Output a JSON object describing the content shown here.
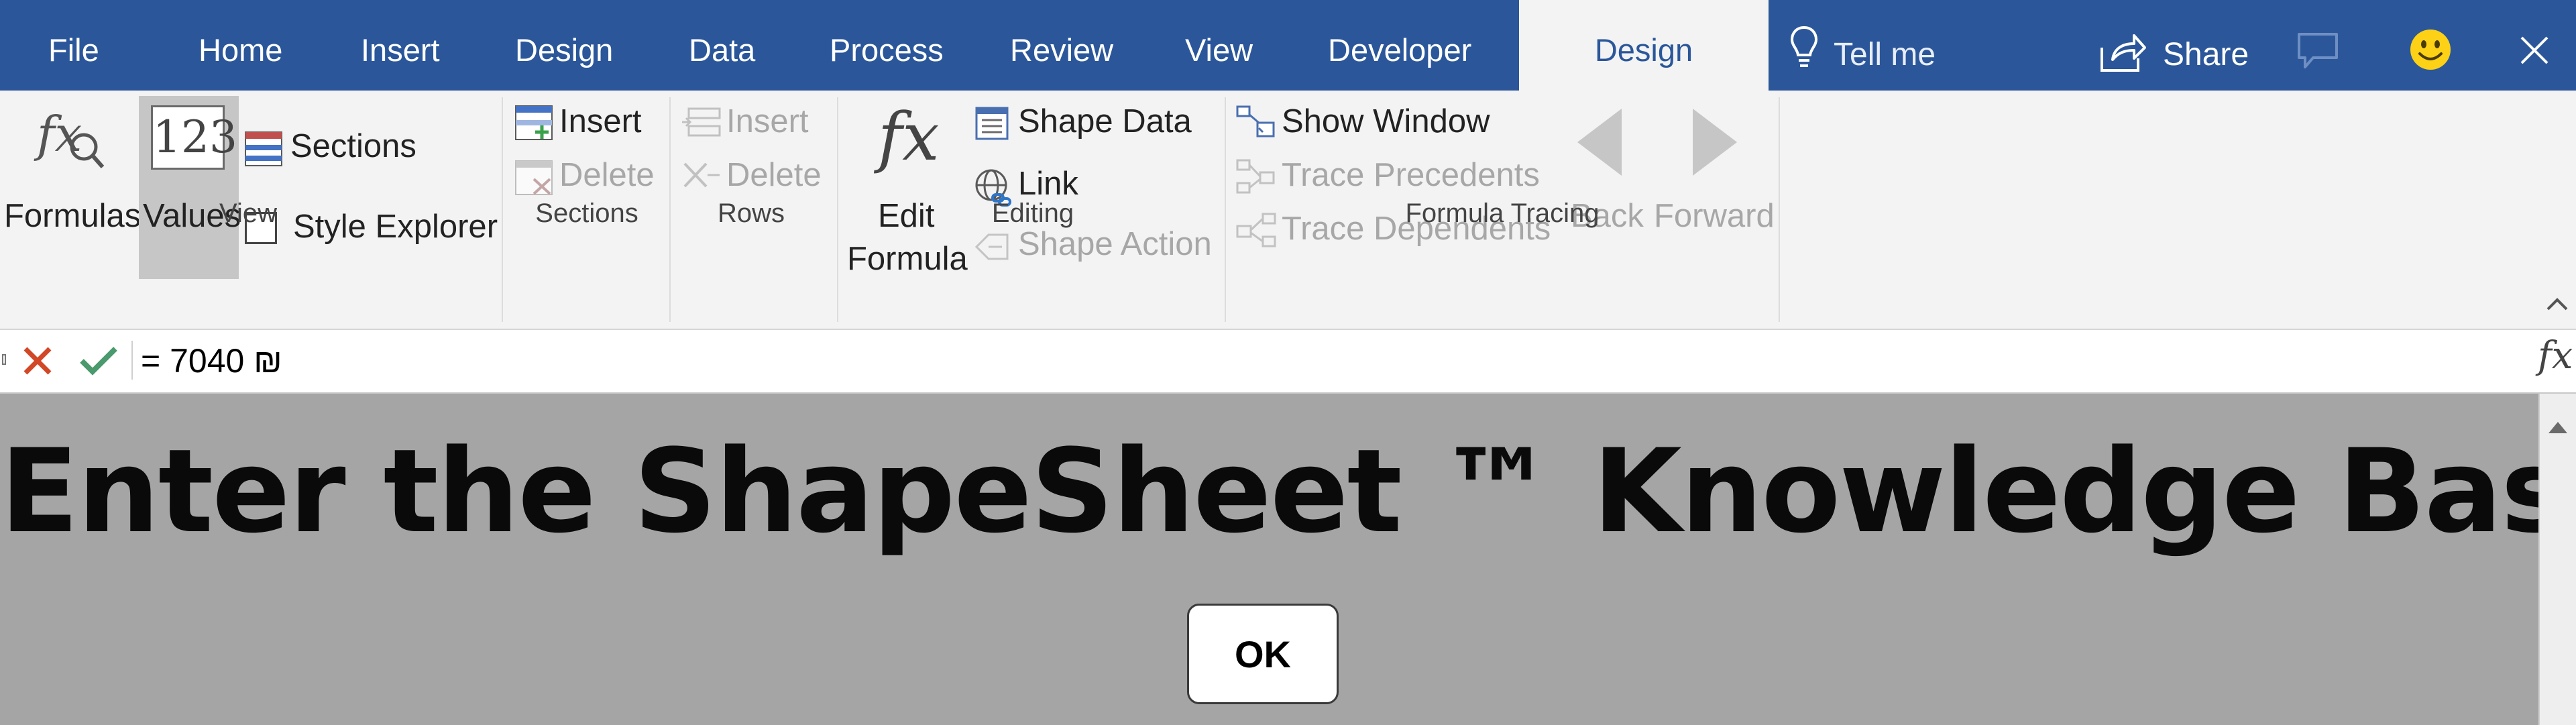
{
  "tabs": [
    {
      "label": "File"
    },
    {
      "label": "Home"
    },
    {
      "label": "Insert"
    },
    {
      "label": "Design"
    },
    {
      "label": "Data"
    },
    {
      "label": "Process"
    },
    {
      "label": "Review"
    },
    {
      "label": "View"
    },
    {
      "label": "Developer"
    },
    {
      "label": "Design",
      "active": true
    }
  ],
  "tell_me": {
    "label": "Tell me"
  },
  "share": {
    "label": "Share"
  },
  "ribbon": {
    "view": {
      "group_label": "View",
      "formulas": "Formulas",
      "values": "Values",
      "values_icon_text": "123",
      "sections": "Sections",
      "style_explorer": "Style Explorer"
    },
    "sections": {
      "group_label": "Sections",
      "insert": "Insert",
      "delete": "Delete"
    },
    "rows": {
      "group_label": "Rows",
      "insert": "Insert",
      "delete": "Delete"
    },
    "editing": {
      "group_label": "Editing",
      "fx_glyph": "fx",
      "edit_formula_line1": "Edit",
      "edit_formula_line2": "Formula",
      "shape_data": "Shape Data",
      "link": "Link",
      "shape_action": "Shape Action"
    },
    "formula_tracing": {
      "group_label": "Formula Tracing",
      "show_window": "Show Window",
      "trace_precedents": "Trace Precedents",
      "trace_dependents": "Trace Dependents",
      "back": "Back",
      "forward": "Forward"
    }
  },
  "formula_bar": {
    "value": "= 7040 ₪",
    "fx_glyph": "fx"
  },
  "content": {
    "title": "Enter the ShapeSheet ™ Knowledge Base",
    "ok": "OK"
  },
  "colors": {
    "tab_bar": "#2b579a",
    "ribbon": "#f3f3f3",
    "content_bg": "#a5a5a5",
    "cancel": "#d24726",
    "confirm": "#4a9a6e"
  }
}
